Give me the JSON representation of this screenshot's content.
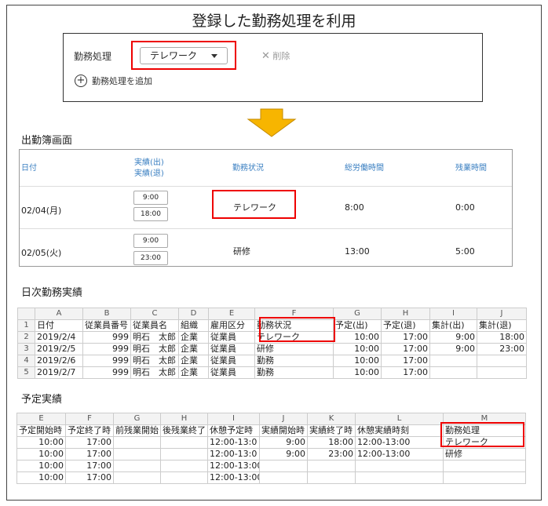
{
  "title": "登録した勤務処理を利用",
  "work_setting": {
    "label": "勤務処理",
    "selected": "テレワーク",
    "delete_label": "削除",
    "add_label": "勤務処理を追加"
  },
  "attendance": {
    "section_title": "出勤簿画面",
    "headers": {
      "date": "日付",
      "actual_in": "実績(出)",
      "actual_out": "実績(退)",
      "status": "勤務状況",
      "total": "総労働時間",
      "overtime": "残業時間"
    },
    "rows": [
      {
        "date": "02/04(月)",
        "in": "9:00",
        "out": "18:00",
        "status": "テレワーク",
        "total": "8:00",
        "overtime": "0:00"
      },
      {
        "date": "02/05(火)",
        "in": "9:00",
        "out": "23:00",
        "status": "研修",
        "total": "13:00",
        "overtime": "5:00"
      }
    ]
  },
  "daily": {
    "section_title": "日次勤務実績",
    "columns": [
      "A",
      "B",
      "C",
      "D",
      "E",
      "F",
      "G",
      "H",
      "I",
      "J"
    ],
    "header": [
      "日付",
      "従業員番号",
      "従業員名",
      "組織",
      "雇用区分",
      "勤務状況",
      "予定(出)",
      "予定(退)",
      "集計(出)",
      "集計(退)"
    ],
    "rows": [
      [
        "2019/2/4",
        "999",
        "明石　太郎",
        "企業",
        "従業員",
        "テレワーク",
        "10:00",
        "17:00",
        "9:00",
        "18:00"
      ],
      [
        "2019/2/5",
        "999",
        "明石　太郎",
        "企業",
        "従業員",
        "研修",
        "10:00",
        "17:00",
        "9:00",
        "23:00"
      ],
      [
        "2019/2/6",
        "999",
        "明石　太郎",
        "企業",
        "従業員",
        "勤務",
        "10:00",
        "17:00",
        "",
        ""
      ],
      [
        "2019/2/7",
        "999",
        "明石　太郎",
        "企業",
        "従業員",
        "勤務",
        "10:00",
        "17:00",
        "",
        ""
      ]
    ]
  },
  "schedule": {
    "section_title": "予定実績",
    "columns": [
      "E",
      "F",
      "G",
      "H",
      "I",
      "J",
      "K",
      "L",
      "M"
    ],
    "header": [
      "予定開始時",
      "予定終了時",
      "前残業開始",
      "後残業終了",
      "休憩予定時",
      "実績開始時",
      "実績終了時",
      "休憩実績時刻",
      "勤務処理"
    ],
    "rows": [
      [
        "10:00",
        "17:00",
        "",
        "",
        "12:00-13:0",
        "9:00",
        "18:00",
        "12:00-13:00",
        "テレワーク"
      ],
      [
        "10:00",
        "17:00",
        "",
        "",
        "12:00-13:0",
        "9:00",
        "23:00",
        "12:00-13:00",
        "研修"
      ],
      [
        "10:00",
        "17:00",
        "",
        "",
        "12:00-13:00",
        "",
        "",
        "",
        ""
      ],
      [
        "10:00",
        "17:00",
        "",
        "",
        "12:00-13:00",
        "",
        "",
        "",
        ""
      ]
    ]
  }
}
